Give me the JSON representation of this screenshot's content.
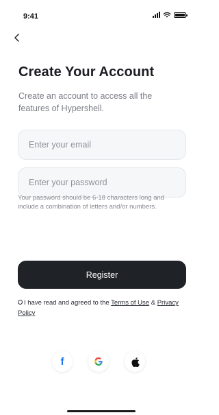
{
  "status_bar": {
    "time": "9:41"
  },
  "screen": {
    "title": "Create Your Account",
    "subtitle": "Create an account to access all the features of Hypershell."
  },
  "form": {
    "email_placeholder": "Enter your email",
    "email_value": "",
    "password_placeholder": "Enter your password",
    "password_value": "",
    "password_hint": "Your password should be 6-18 characters long and include a combination of letters and/or numbers."
  },
  "actions": {
    "register_label": "Register"
  },
  "terms": {
    "prefix": "I have read and agreed to the ",
    "terms_link": "Terms of Use",
    "separator": " & ",
    "privacy_link": "Privacy Policy",
    "checked": false
  },
  "social": {
    "facebook_glyph": "f",
    "icons": [
      "facebook-icon",
      "google-icon",
      "apple-icon"
    ]
  },
  "colors": {
    "primary_button": "#1f2227",
    "field_background": "#f6f7f9",
    "facebook": "#1877f2",
    "google_blue": "#4285f4",
    "google_red": "#ea4335",
    "google_yellow": "#fbbc05",
    "google_green": "#34a853"
  }
}
